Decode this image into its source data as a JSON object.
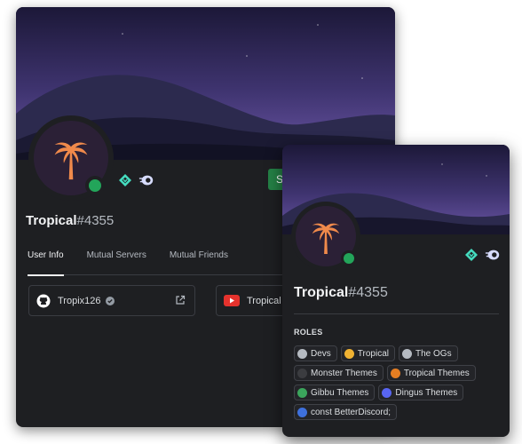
{
  "back_profile": {
    "username": "Tropical",
    "discriminator": "#4355",
    "button_label": "S",
    "tabs": [
      {
        "label": "User Info"
      },
      {
        "label": "Mutual Servers"
      },
      {
        "label": "Mutual Friends"
      }
    ],
    "connections": [
      {
        "service": "github-icon",
        "name": "Tropix126",
        "verified": true
      },
      {
        "service": "youtube-icon",
        "name": "Tropical"
      }
    ]
  },
  "popout": {
    "username": "Tropical",
    "discriminator": "#4355",
    "roles_heading": "ROLES",
    "roles": [
      {
        "name": "Devs",
        "color": "#b5bac1"
      },
      {
        "name": "Tropical",
        "color": "#f0b232"
      },
      {
        "name": "The OGs",
        "color": "#b5bac1"
      },
      {
        "name": "Monster Themes",
        "color": "#3b3c40"
      },
      {
        "name": "Tropical Themes",
        "color": "#e67e22"
      },
      {
        "name": "Gibbu Themes",
        "color": "#3ba55c"
      },
      {
        "name": "Dingus Themes",
        "color": "#5865f2"
      },
      {
        "name": "const BetterDiscord;",
        "color": "#3e70dd"
      }
    ]
  },
  "colors": {
    "online": "#23a55a",
    "card_bg": "#1e1f22",
    "palm": "#f08a4b"
  }
}
